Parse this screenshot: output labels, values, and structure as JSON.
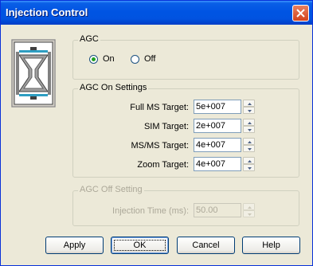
{
  "window": {
    "title": "Injection Control"
  },
  "agc": {
    "legend": "AGC",
    "on_label": "On",
    "off_label": "Off",
    "selected": "On"
  },
  "agc_on": {
    "legend": "AGC On Settings",
    "rows": [
      {
        "label": "Full MS Target:",
        "value": "5e+007"
      },
      {
        "label": "SIM Target:",
        "value": "2e+007"
      },
      {
        "label": "MS/MS Target:",
        "value": "4e+007"
      },
      {
        "label": "Zoom Target:",
        "value": "4e+007"
      }
    ]
  },
  "agc_off": {
    "legend": "AGC Off Setting",
    "injection_label": "Injection Time (ms):",
    "injection_value": "50.00"
  },
  "buttons": {
    "apply": "Apply",
    "ok": "OK",
    "cancel": "Cancel",
    "help": "Help"
  },
  "icons": {
    "close": "close-icon",
    "instrument": "ion-trap-icon"
  },
  "colors": {
    "titlebar": "#0054e3",
    "face": "#ece9d8",
    "radio_dot": "#21a121"
  }
}
